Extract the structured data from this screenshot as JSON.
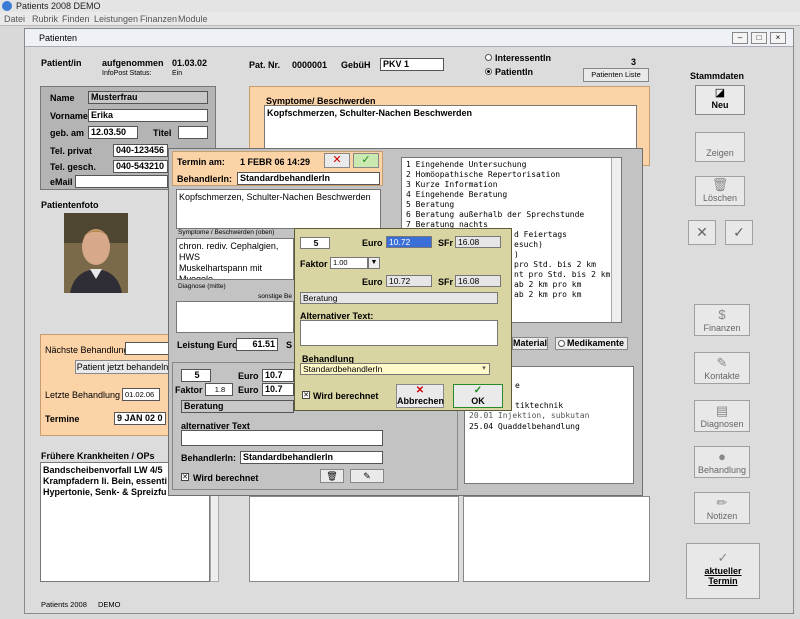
{
  "app": {
    "title": "Patients 2008 DEMO",
    "menu": [
      "Datei",
      "Rubrik",
      "Finden",
      "Leistungen",
      "Finanzen",
      "Module"
    ]
  },
  "window": {
    "title": "Patienten"
  },
  "header": {
    "patient_label": "Patient/in",
    "aufgenommen_label": "aufgenommen",
    "aufgenommen_date": "01.03.02",
    "infopost_label": "InfoPost Status:",
    "infopost_value": "Ein",
    "patnr_label": "Pat. Nr.",
    "patnr_value": "0000001",
    "gebuh_label": "GebüH",
    "gebuh_value": "PKV 1",
    "radio_interessent": "InteressentIn",
    "radio_patient": "PatientIn",
    "count": "3",
    "patientenliste": "Patienten Liste",
    "stammdaten": "Stammdaten"
  },
  "person": {
    "name_label": "Name",
    "name": "Musterfrau",
    "vorname_label": "Vorname",
    "vorname": "Erika",
    "geb_label": "geb. am",
    "geb": "12.03.50",
    "titel_label": "Titel",
    "titel": "",
    "tel_privat_label": "Tel. privat",
    "tel_privat": "040-123456",
    "tel_gesch_label": "Tel. gesch.",
    "tel_gesch": "040-543210",
    "email_label": "eMail",
    "email": ""
  },
  "patientenfoto": "Patientenfoto",
  "behandlung": {
    "naechste_label": "Nächste Behandlung",
    "jetzt_button": "Patient jetzt behandeln",
    "letzte_label": "Letzte Behandlung",
    "letzte_date": "01.02.06",
    "termine_label": "Termine",
    "termine_value": "9 JAN 02 0"
  },
  "frueher": {
    "label": "Frühere Krankheiten / OPs",
    "lines": [
      "Bandscheibenvorfall LW 4/5",
      "Krampfadern li. Bein, essenti",
      "Hypertonie, Senk- & Spreizfu"
    ]
  },
  "symptome": {
    "label": "Symptome/ Beschwerden",
    "text": "Kopfschmerzen, Schulter-Nachen Beschwerden"
  },
  "sidebar": {
    "neu": "Neu",
    "zeigen": "Zeigen",
    "loeschen": "Löschen",
    "finanzen": "Finanzen",
    "kontakte": "Kontakte",
    "diagnosen": "Diagnosen",
    "behandlung": "Behandlung",
    "notizen": "Notizen",
    "aktueller": "aktueller",
    "termin": "Termin"
  },
  "footer": {
    "app": "Patients 2008",
    "mode": "DEMO"
  },
  "termin": {
    "termin_label": "Termin am:",
    "termin_value": "1 FEBR 06  14:29",
    "behandler_label": "BehandlerIn:",
    "behandler_value": "Standardbehandlerln",
    "symptome_text": "Kopfschmerzen, Schulter-Nachen Beschwerden",
    "symptome_caption": "Symptome / Beschwerden (oben)",
    "diagnose_text": [
      "chron. rediv. Cephalgien, HWS",
      "Muskelhartspann mit Myogelo"
    ],
    "diagnose_caption": "Diagnose (mitte)",
    "sonstige_caption": "sonstige Be",
    "leistung_label": "Leistung Euro",
    "leistung_value": "61.51",
    "s_label": "S",
    "material": "Material",
    "medikamente": "Medikamente",
    "list_items": [
      {
        "num": "1",
        "text": "Eingehende Untersuchung"
      },
      {
        "num": "2",
        "text": "Homöopathische Repertorisation"
      },
      {
        "num": "3",
        "text": "Kurze Information"
      },
      {
        "num": "4",
        "text": "Eingehende Beratung"
      },
      {
        "num": "5",
        "text": "Beratung"
      },
      {
        "num": "6",
        "text": "Beratung außerhalb der Sprechstunde"
      },
      {
        "num": "7",
        "text": "Beratung nachts"
      }
    ],
    "list_partial": [
      "d Feiertags",
      "esuch)",
      ")",
      "pro Std. bis 2 km",
      "nt pro Std. bis 2 km",
      "ab 2 km pro km",
      "ab 2 km pro km"
    ],
    "lower_list": [
      "e",
      "tiktechnik",
      "in/ intrakutan"
    ],
    "lower_last": "25.04  Quaddelbehandlung",
    "lower_partial": "20.01  Injektion, subkutan",
    "qty": "5",
    "euro_label": "Euro",
    "euro_value": "10.7",
    "faktor_label": "Faktor",
    "faktor_value": "1.8",
    "euro_value2": "10.7",
    "beratung": "Beratung",
    "alt_label": "alternativer Text",
    "behandler2_label": "BehandlerIn:",
    "behandler2_value": "Standardbehandlerln",
    "wird_berechnet": "Wird berechnet"
  },
  "dialog": {
    "qty": "5",
    "euro_label": "Euro",
    "euro_value": "10.72",
    "sfr_label": "SFr",
    "sfr_value": "16.08",
    "faktor_label": "Faktor",
    "faktor_value": "1.00",
    "euro_label2": "Euro",
    "euro_value2": "10.72",
    "sfr_label2": "SFr",
    "sfr_value2": "16.08",
    "beratung": "Beratung",
    "alt_label": "Alternativer Text:",
    "behandlung_label": "Behandlung",
    "behandlung_value": "StandardbehandlerIn",
    "wird_berechnet": "Wird berechnet",
    "abbrechen": "Abbrechen",
    "ok": "OK"
  },
  "colors": {
    "orange": "#fbd3a7",
    "dialog": "#d9d5a3",
    "selected": "#3a6fd8"
  }
}
